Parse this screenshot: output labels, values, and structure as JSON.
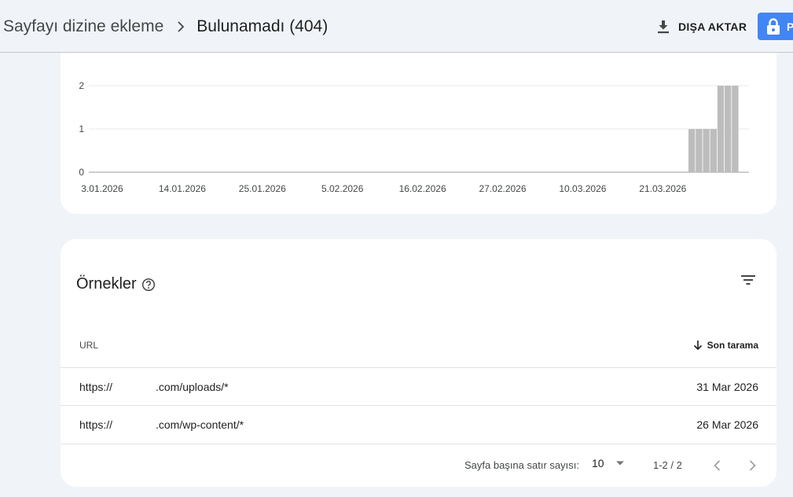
{
  "header": {
    "breadcrumb_root": "Sayfayı dizine ekleme",
    "breadcrumb_current": "Bulunamadı (404)",
    "export_label": "DIŞA AKTAR",
    "lock_button_label": "P"
  },
  "chart_data": {
    "type": "bar",
    "title": "",
    "xlabel": "",
    "ylabel": "",
    "ylim": [
      0,
      2
    ],
    "y_ticks": [
      "0",
      "1",
      "2"
    ],
    "x_ticks": [
      "3.01.2026",
      "14.01.2026",
      "25.01.2026",
      "5.02.2026",
      "16.02.2026",
      "27.02.2026",
      "10.03.2026",
      "21.03.2026"
    ],
    "categories": [
      "2026-03-26",
      "2026-03-27",
      "2026-03-28",
      "2026-03-29",
      "2026-03-30",
      "2026-03-31",
      "2026-04-01"
    ],
    "values": [
      1,
      1,
      1,
      1,
      2,
      2,
      2
    ],
    "bar_color": "#bdbdbd",
    "grid": true
  },
  "examples": {
    "title": "Örnekler",
    "url_header": "URL",
    "sort_header": "Son tarama",
    "rows": [
      {
        "url_prefix": "https://",
        "url_path": ".com/uploads/*",
        "date": "31 Mar 2026"
      },
      {
        "url_prefix": "https://",
        "url_path": ".com/wp-content/*",
        "date": "26 Mar 2026"
      }
    ],
    "pagination": {
      "rows_per_page_label": "Sayfa başına satır sayısı:",
      "rows_per_page_value": "10",
      "range": "1-2 / 2"
    }
  },
  "colors": {
    "background": "#f0f4f9",
    "accent": "#4285f4",
    "bar": "#bdbdbd"
  }
}
